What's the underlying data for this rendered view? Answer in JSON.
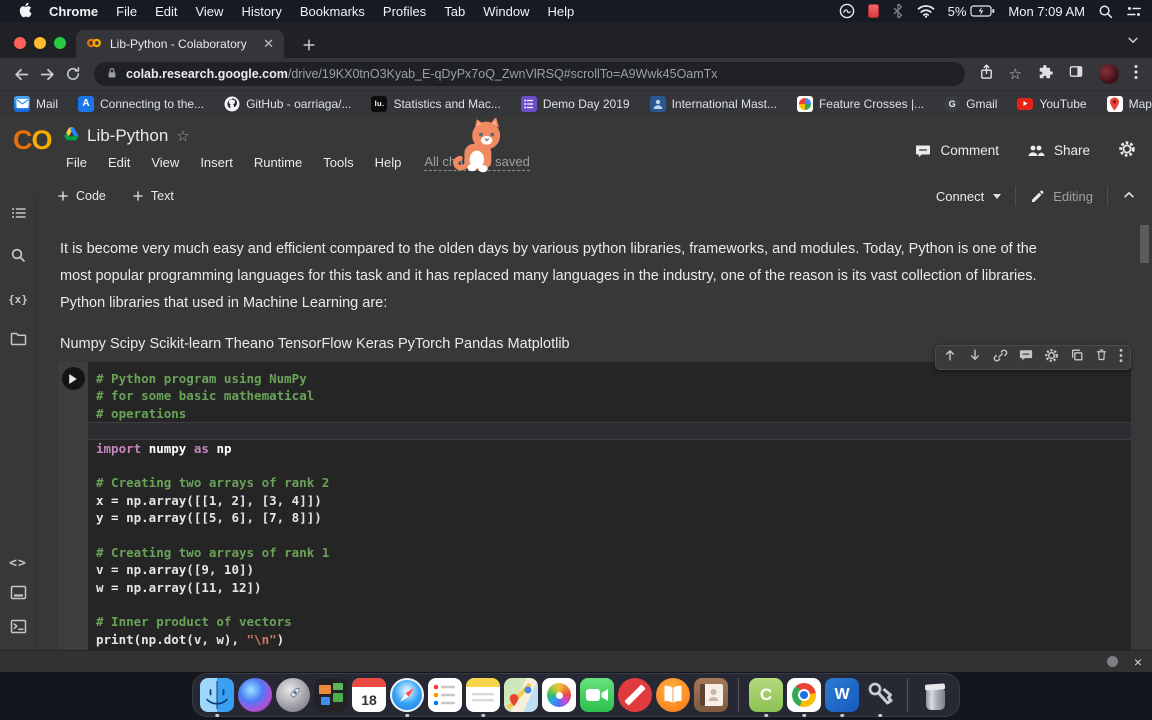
{
  "colors": {
    "accent_orange": "#F9AB00",
    "logo_orange_dark": "#E8710A",
    "comment_green": "#69A358",
    "keyword_purple": "#C586C0",
    "string_red": "#CF7763",
    "colab_bg": "#383838",
    "editor_bg": "#252526",
    "chrome_dark": "#202124",
    "chrome_toolbar": "#35363A"
  },
  "macos": {
    "menus": [
      "Chrome",
      "File",
      "Edit",
      "View",
      "History",
      "Bookmarks",
      "Profiles",
      "Tab",
      "Window",
      "Help"
    ],
    "status": {
      "battery": "5%",
      "clock": "Mon 7:09 AM"
    },
    "status_icons": [
      "adobe-cc",
      "red-panel",
      "bluetooth",
      "wifi",
      "battery-charging",
      "spotlight",
      "control-list"
    ]
  },
  "chrome": {
    "tab": {
      "title": "Lib-Python - Colaboratory"
    },
    "url": {
      "domain": "colab.research.google.com",
      "path": "/drive/19KX0tnO3Kyab_E-qDyPx7oQ_ZwnVlRSQ#scrollTo=A9Wwk45OamTx"
    },
    "bookmarks": [
      {
        "icon": "mail",
        "label": "Mail"
      },
      {
        "icon": "appstore",
        "label": "Connecting to the...",
        "letter": "A"
      },
      {
        "icon": "github",
        "label": "GitHub - oarriaga/..."
      },
      {
        "icon": "lynda",
        "label": "Statistics and Mac...",
        "letter": "lu."
      },
      {
        "icon": "demoday",
        "label": "Demo Day 2019"
      },
      {
        "icon": "intl",
        "label": "International Mast..."
      },
      {
        "icon": "feature",
        "label": "Feature Crosses  |..."
      },
      {
        "icon": "gmail",
        "label": "Gmail",
        "letter": "G"
      },
      {
        "icon": "youtube",
        "label": "YouTube"
      },
      {
        "icon": "gmaps",
        "label": "Maps"
      }
    ],
    "overflow": "»"
  },
  "colab": {
    "logo": {
      "c": "C",
      "o": "O"
    },
    "title": "Lib-Python",
    "menu": [
      "File",
      "Edit",
      "View",
      "Insert",
      "Runtime",
      "Tools",
      "Help"
    ],
    "autosave": "All changes saved",
    "comment_label": "Comment",
    "share_label": "Share",
    "toolbar": {
      "code": "Code",
      "text": "Text",
      "connect": "Connect",
      "mode": "Editing"
    },
    "sidebar_top": [
      "table-of-contents",
      "search",
      "variables",
      "files"
    ],
    "sidebar_bottom": [
      "code-snippets",
      "command-palette",
      "terminal"
    ],
    "sidebar_text_icons": {
      "variables": "{x}",
      "code_snippets": "<>"
    }
  },
  "content": {
    "p1": "It is become very much easy and efficient compared to the olden days by various python libraries, frameworks, and modules. Today, Python is one of the most popular programming languages for this task and it has replaced many languages in the industry, one of the reason is its vast collection of libraries. Python libraries that used in Machine Learning are:",
    "p2": "Numpy Scipy Scikit-learn Theano TensorFlow Keras PyTorch Pandas Matplotlib"
  },
  "cell": {
    "toolbar_icons": [
      "move-cell-up",
      "move-cell-down",
      "copy-link",
      "add-comment",
      "cell-settings",
      "copy-cell",
      "delete-cell",
      "more-actions"
    ],
    "code_lines": [
      {
        "segs": [
          [
            "comment",
            "# Python program using NumPy"
          ]
        ]
      },
      {
        "segs": [
          [
            "comment",
            "# for some basic mathematical"
          ]
        ]
      },
      {
        "segs": [
          [
            "comment",
            "# operations"
          ]
        ]
      },
      {
        "hl": true,
        "segs": []
      },
      {
        "segs": [
          [
            "keyword",
            "import"
          ],
          [
            "plain",
            " "
          ],
          [
            "bold",
            "numpy"
          ],
          [
            "plain",
            " "
          ],
          [
            "keyword",
            "as"
          ],
          [
            "plain",
            " "
          ],
          [
            "bold",
            "np"
          ]
        ]
      },
      {
        "segs": []
      },
      {
        "segs": [
          [
            "comment",
            "# Creating two arrays of rank 2"
          ]
        ]
      },
      {
        "segs": [
          [
            "plain",
            "x = np.array([[1, 2], [3, 4]])"
          ]
        ]
      },
      {
        "segs": [
          [
            "plain",
            "y = np.array([[5, 6], [7, 8]])"
          ]
        ]
      },
      {
        "segs": []
      },
      {
        "segs": [
          [
            "comment",
            "# Creating two arrays of rank 1"
          ]
        ]
      },
      {
        "segs": [
          [
            "plain",
            "v = np.array([9, 10])"
          ]
        ]
      },
      {
        "segs": [
          [
            "plain",
            "w = np.array([11, 12])"
          ]
        ]
      },
      {
        "segs": []
      },
      {
        "segs": [
          [
            "comment",
            "# Inner product of vectors"
          ]
        ]
      },
      {
        "segs": [
          [
            "plain",
            "print(np.dot(v, w), "
          ],
          [
            "string",
            "\"\\n\""
          ],
          [
            "plain",
            ")"
          ]
        ]
      }
    ]
  },
  "statusbar": {
    "close": "×"
  },
  "dock": {
    "items": [
      {
        "name": "finder",
        "dot": true
      },
      {
        "name": "siri"
      },
      {
        "name": "launchpad"
      },
      {
        "name": "mission-control"
      },
      {
        "name": "calendar",
        "label": "18"
      },
      {
        "name": "safari",
        "dot": true
      },
      {
        "name": "reminders"
      },
      {
        "name": "notes",
        "dot": true
      },
      {
        "name": "maps"
      },
      {
        "name": "photos"
      },
      {
        "name": "facetime"
      },
      {
        "name": "no-entry"
      },
      {
        "name": "books"
      },
      {
        "name": "contacts"
      },
      {
        "name": "divider"
      },
      {
        "name": "camtasia",
        "label": "C",
        "dot": true
      },
      {
        "name": "chrome",
        "dot": true
      },
      {
        "name": "word",
        "label": "W",
        "dot": true
      },
      {
        "name": "keychain",
        "dot": true
      },
      {
        "name": "divider"
      },
      {
        "name": "trash"
      }
    ]
  }
}
